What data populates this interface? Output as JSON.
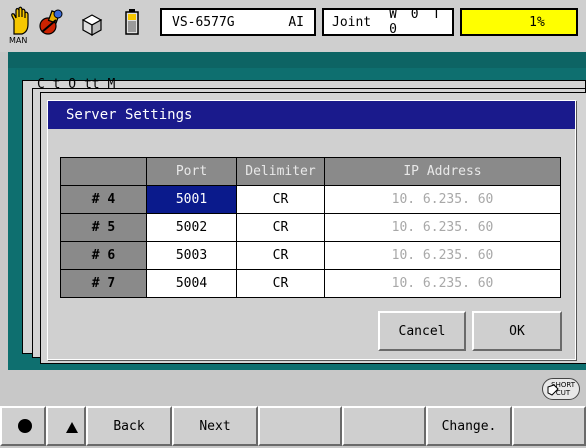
{
  "toolbar": {
    "man_label": "MAN",
    "robot_model": "VS-6577G",
    "robot_mode": "AI",
    "coord_label": "Joint",
    "tool_status": "W 0 T 0",
    "speed": "1%"
  },
  "background_windows": {
    "partial_title": "C          t   O  tt   M",
    "side_text": "f"
  },
  "dialog": {
    "title": "Server Settings",
    "columns": [
      "Port",
      "Delimiter",
      "IP Address"
    ],
    "rows": [
      {
        "id": "# 4",
        "port": "5001",
        "delimiter": "CR",
        "ip": "10.  6.235. 60"
      },
      {
        "id": "# 5",
        "port": "5002",
        "delimiter": "CR",
        "ip": "10.  6.235. 60"
      },
      {
        "id": "# 6",
        "port": "5003",
        "delimiter": "CR",
        "ip": "10.  6.235. 60"
      },
      {
        "id": "# 7",
        "port": "5004",
        "delimiter": "CR",
        "ip": "10.  6.235. 60"
      }
    ],
    "cancel_label": "Cancel",
    "ok_label": "OK"
  },
  "shortcut": {
    "line1": "SHORT",
    "line2": "CUT"
  },
  "function_keys": {
    "back": "Back",
    "next": "Next",
    "change": "Change."
  },
  "colors": {
    "title_bar": "#1a1a8c",
    "selection": "#0a1a8c",
    "speed_bg": "#ffff00",
    "main_bg": "#0e6f6f"
  },
  "icons": [
    "hand-icon",
    "robot-icon",
    "box-icon",
    "battery-icon",
    "shortcut-icon"
  ]
}
